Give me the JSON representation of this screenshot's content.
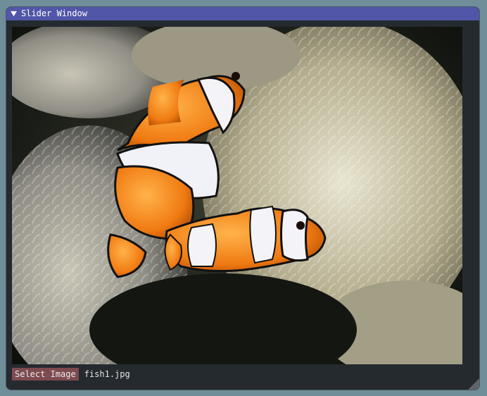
{
  "window": {
    "title": "Slider Window",
    "title_bar_color": "#5156a8",
    "background_color": "#252a2f"
  },
  "image": {
    "description_icon": "image-preview",
    "filename": "fish1.jpg"
  },
  "controls": {
    "select_image_label": "Select Image",
    "select_button_color": "#7d4a4f"
  },
  "icons": {
    "collapse": "triangle-down-icon",
    "resize": "resize-grip-icon"
  }
}
